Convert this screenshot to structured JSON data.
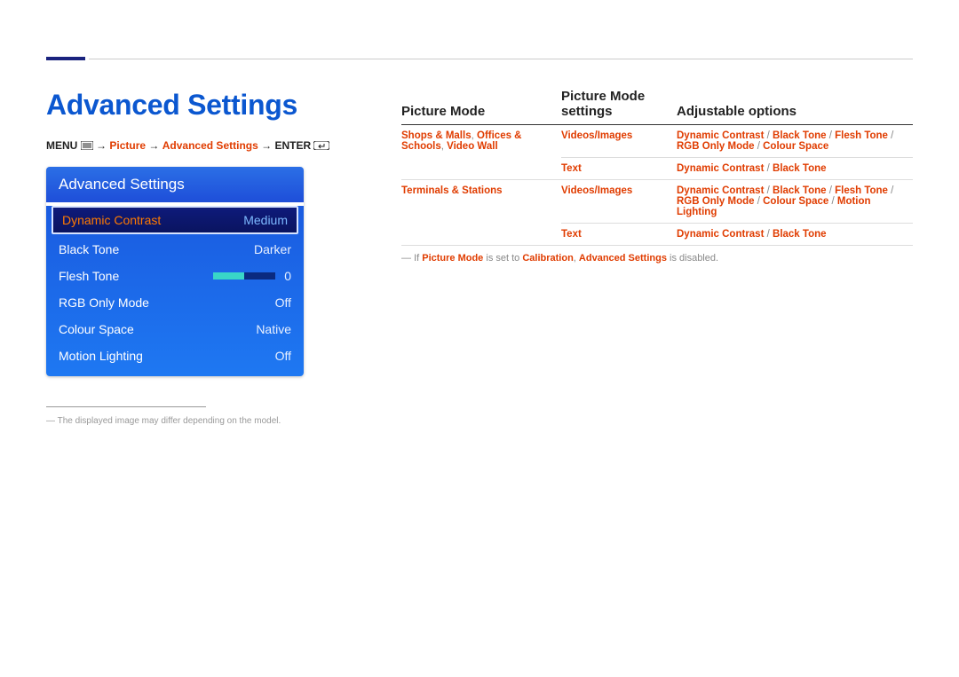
{
  "heading": "Advanced Settings",
  "breadcrumb": {
    "menu": "MENU",
    "arrow": "→",
    "picture": "Picture",
    "adv": "Advanced Settings",
    "enter": "ENTER"
  },
  "osd": {
    "title": "Advanced Settings",
    "rows": [
      {
        "label": "Dynamic Contrast",
        "value": "Medium",
        "selected": true
      },
      {
        "label": "Black Tone",
        "value": "Darker"
      },
      {
        "label": "Flesh Tone",
        "value": "0",
        "slider": true
      },
      {
        "label": "RGB Only Mode",
        "value": "Off"
      },
      {
        "label": "Colour Space",
        "value": "Native"
      },
      {
        "label": "Motion Lighting",
        "value": "Off"
      }
    ]
  },
  "disclaimer": "The displayed image may differ depending on the model.",
  "table": {
    "headers": [
      "Picture Mode",
      "Picture Mode settings",
      "Adjustable options"
    ],
    "rows": [
      {
        "mode_parts": [
          "Shops & Malls",
          ", ",
          "Offices & Schools",
          ", ",
          "Video Wall"
        ],
        "sub": [
          {
            "setting": "Videos/Images",
            "options_parts": [
              "Dynamic Contrast",
              " / ",
              "Black Tone",
              " / ",
              "Flesh Tone",
              " / ",
              "RGB Only Mode",
              " / ",
              "Colour Space"
            ]
          },
          {
            "setting": "Text",
            "options_parts": [
              "Dynamic Contrast",
              " / ",
              "Black Tone"
            ]
          }
        ]
      },
      {
        "mode_parts": [
          "Terminals & Stations"
        ],
        "sub": [
          {
            "setting": "Videos/Images",
            "options_parts": [
              "Dynamic Contrast",
              " / ",
              "Black Tone",
              " / ",
              "Flesh Tone",
              " / ",
              "RGB Only Mode",
              " / ",
              "Colour Space",
              " / ",
              "Motion Lighting"
            ]
          },
          {
            "setting": "Text",
            "options_parts": [
              "Dynamic Contrast",
              " / ",
              "Black Tone"
            ]
          }
        ]
      }
    ]
  },
  "note": {
    "pre": "If ",
    "pm": "Picture Mode",
    "mid": " is set to ",
    "cal": "Calibration",
    "mid2": ", ",
    "as": "Advanced Settings",
    "post": " is disabled."
  }
}
